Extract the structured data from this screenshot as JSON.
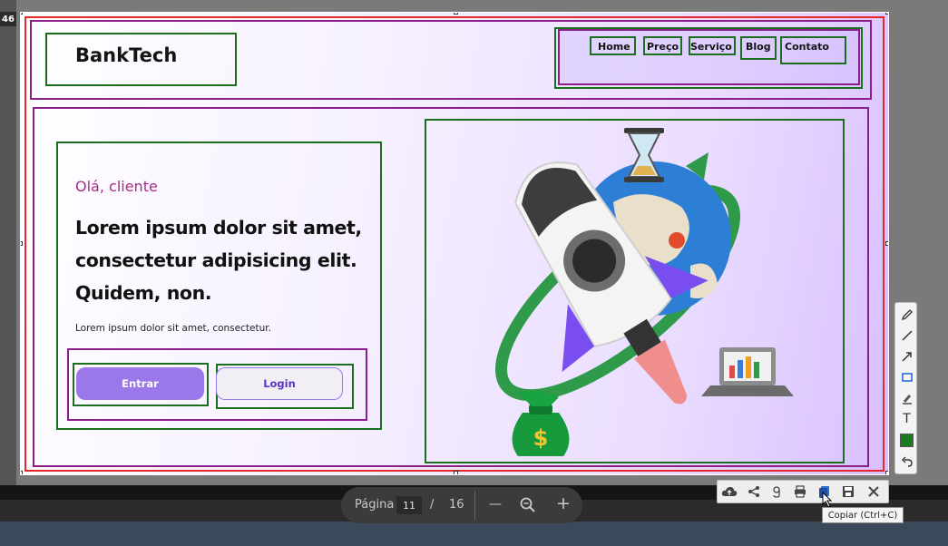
{
  "corner_number": "46",
  "site": {
    "brand": "BankTech",
    "nav": [
      "Home",
      "Preço",
      "Serviço",
      "Blog",
      "Contato"
    ],
    "greeting": "Olá, cliente",
    "headline_lines": [
      "Lorem ipsum dolor sit amet,",
      "consectetur adipisicing elit.",
      "Quidem, non."
    ],
    "subtext": "Lorem ipsum dolor sit amet, consectetur.",
    "buttons": {
      "primary": "Entrar",
      "secondary": "Login"
    },
    "illustration": "rocket-illustration"
  },
  "annotation_colors": {
    "outer": "#e5282c",
    "section": "#8a1f8c",
    "element": "#1b6e1e"
  },
  "pager": {
    "label": "Página",
    "current": "11",
    "separator": "/",
    "total": "16",
    "minus": "—",
    "plus": "+"
  },
  "palette_tools": [
    "pen-icon",
    "line-icon",
    "arrow-icon",
    "rectangle-icon",
    "marker-icon",
    "text-icon",
    "color-swatch",
    "undo-icon"
  ],
  "palette_text_tool": "T",
  "palette_color": "#1b7b1f",
  "toolbar_actions": [
    "upload-cloud-icon",
    "share-icon",
    "google-search-icon",
    "print-icon",
    "copy-icon",
    "save-icon",
    "close-icon"
  ],
  "tooltip": "Copiar (Ctrl+C)"
}
